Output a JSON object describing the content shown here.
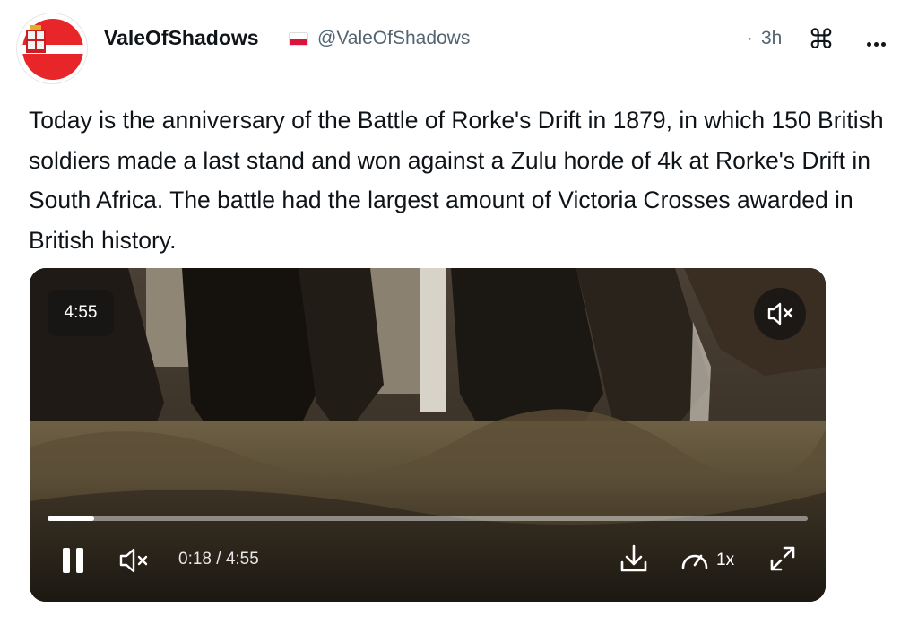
{
  "post": {
    "author_name": "ValeOfShadows",
    "handle": "@ValeOfShadows",
    "separator": "·",
    "timestamp": "3h",
    "text": "Today is the anniversary of the Battle of Rorke's Drift in 1879, in which 150 British soldiers made a last stand and won against a Zulu horde of 4k at Rorke's Drift in South Africa. The battle had the largest amount of Victoria Crosses awarded in British history."
  },
  "video": {
    "duration_badge": "4:55",
    "time_display": "0:18 / 4:55",
    "playback_speed": "1x",
    "progress_fraction": 0.061,
    "muted": true,
    "playing": true
  },
  "icons": {
    "header": [
      "avatar-image",
      "poland-flag-icon",
      "command-icon",
      "more-options-icon"
    ],
    "video": [
      "muted-speaker-icon",
      "pause-icon",
      "download-icon",
      "playback-speed-icon",
      "fullscreen-icon"
    ]
  },
  "colors": {
    "text_primary": "#0f1419",
    "text_secondary": "#536471",
    "avatar_red": "#e8262a",
    "video_overlay": "#141414"
  }
}
